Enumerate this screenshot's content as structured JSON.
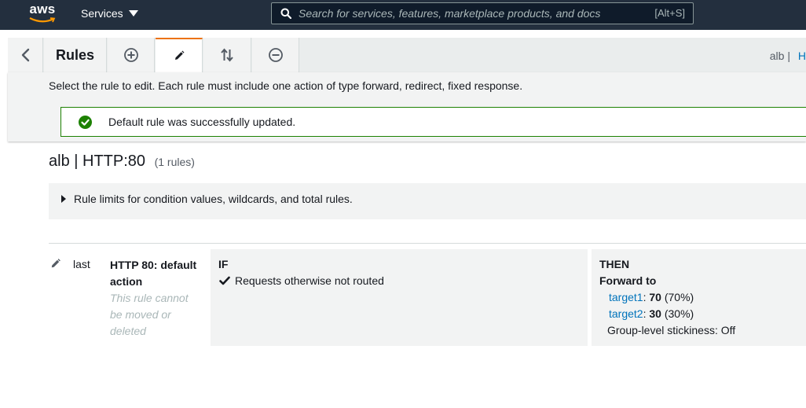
{
  "topnav": {
    "logo_text": "aws",
    "services_label": "Services",
    "search_placeholder": "Search for services, features, marketplace products, and docs",
    "search_shortcut": "[Alt+S]"
  },
  "toolbar": {
    "title": "Rules",
    "breadcrumb_text": "alb",
    "breadcrumb_separator": "|",
    "breadcrumb_link_fragment": "H",
    "active_tab_color": "#ec7211"
  },
  "panel": {
    "instructions": "Select the rule to edit. Each rule must include one action of type forward, redirect, fixed response.",
    "alert_text": "Default rule was successfully updated.",
    "alert_color": "#1d8102"
  },
  "listener": {
    "heading": "alb | HTTP:80",
    "rule_count": "(1 rules)"
  },
  "limits": {
    "label": "Rule limits for condition values, wildcards, and total rules."
  },
  "rule": {
    "priority": "last",
    "name": "HTTP 80: default action",
    "note": "This rule cannot be moved or deleted",
    "if_label": "IF",
    "condition": "Requests otherwise not routed",
    "then_label": "THEN",
    "action": "Forward to",
    "targets": [
      {
        "name": "target1",
        "separator": ":",
        "weight": "70",
        "percent": "(70%)"
      },
      {
        "name": "target2",
        "separator": ":",
        "weight": "30",
        "percent": "(30%)"
      }
    ],
    "stickiness": "Group-level stickiness: Off",
    "link_color": "#0073bb"
  }
}
